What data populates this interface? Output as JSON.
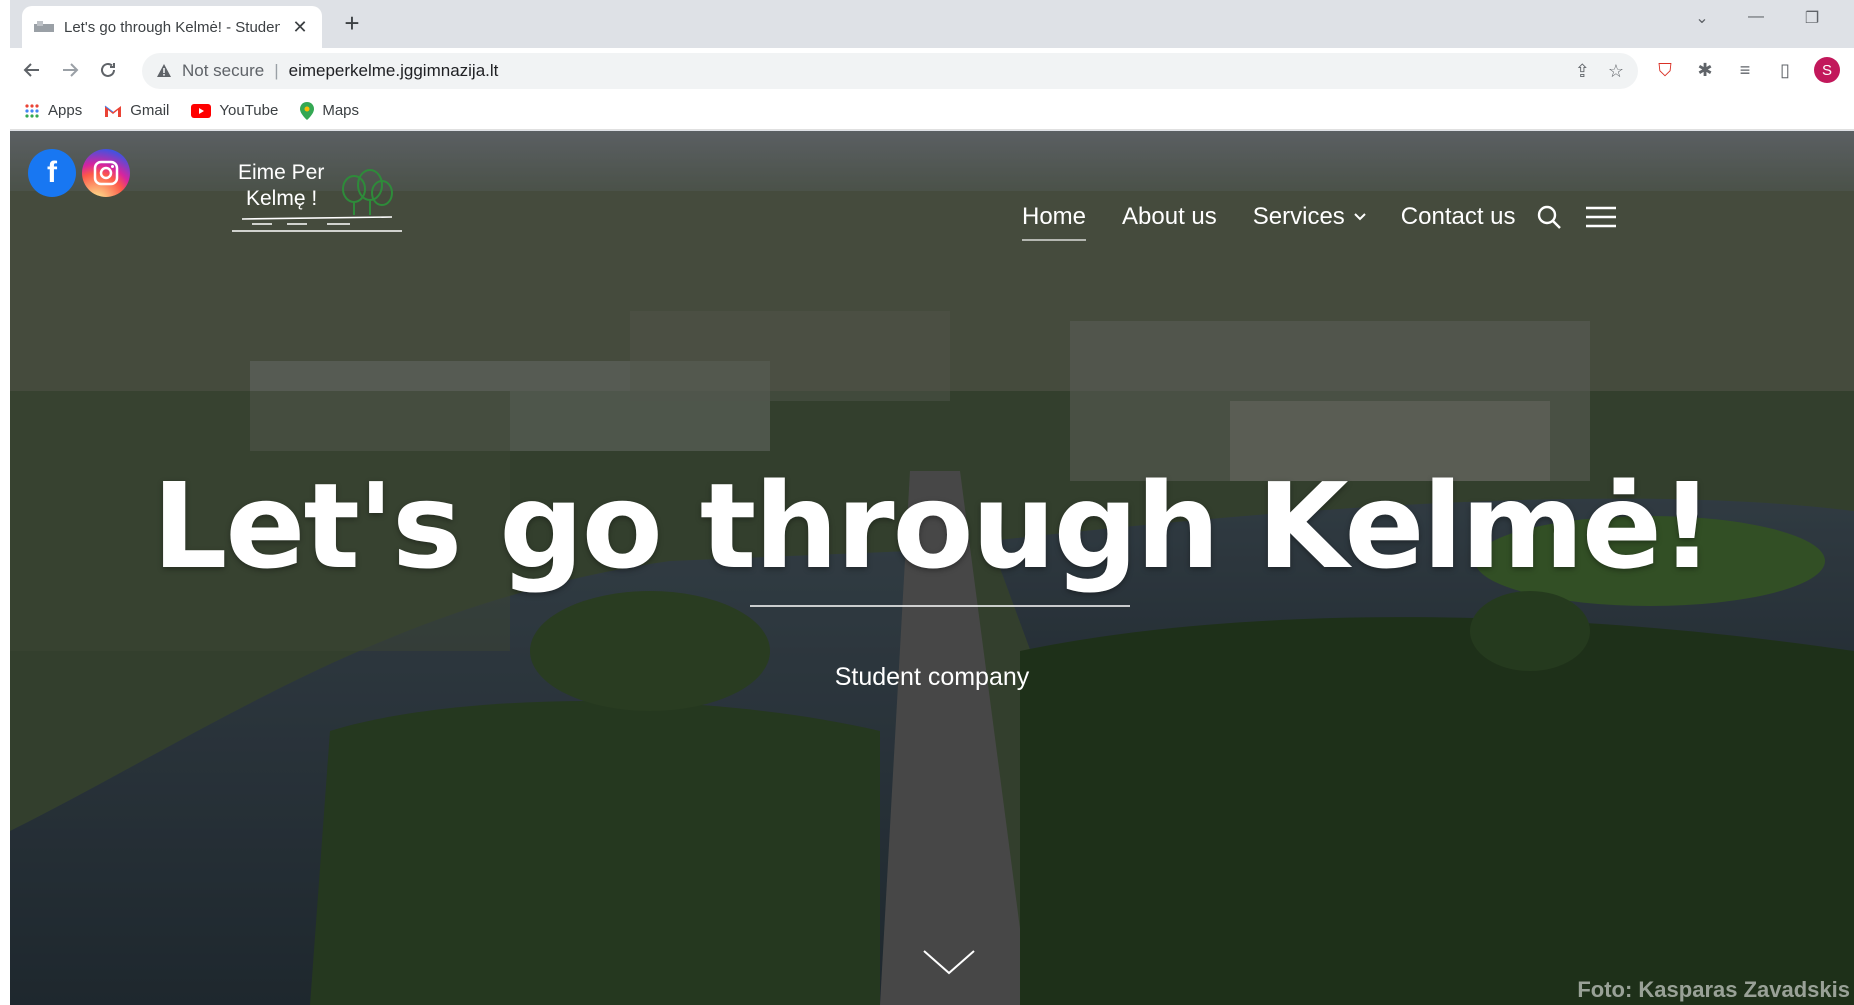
{
  "browser": {
    "tab_title": "Let's go through Kelmė! - Studen",
    "security_label": "Not secure",
    "url": "eimeperkelme.jggimnazija.lt",
    "profile_initial": "S",
    "bookmarks": [
      {
        "label": "Apps",
        "icon": "apps-grid-icon"
      },
      {
        "label": "Gmail",
        "icon": "gmail-icon"
      },
      {
        "label": "YouTube",
        "icon": "youtube-icon"
      },
      {
        "label": "Maps",
        "icon": "maps-pin-icon"
      }
    ]
  },
  "site": {
    "logo": {
      "line1": "Eime Per",
      "line2": "Kelmę !"
    },
    "nav": {
      "home": "Home",
      "about": "About us",
      "services": "Services",
      "contact": "Contact us"
    },
    "hero": {
      "title": "Let's go through Kelmė!",
      "subtitle": "Student company"
    },
    "photo_credit": "Foto: Kasparas Zavadskis",
    "colors": {
      "facebook": "#1877f2",
      "profile": "#c2185b"
    }
  }
}
